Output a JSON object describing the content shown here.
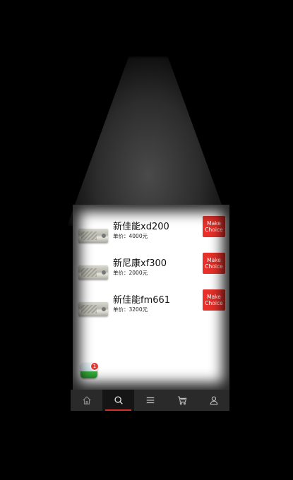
{
  "products": [
    {
      "name": "新佳能xd200",
      "price": "单价：4000元",
      "button": "Make Choice"
    },
    {
      "name": "新尼康xf300",
      "price": "单价：2000元",
      "button": "Make Choice"
    },
    {
      "name": "新佳能fm661",
      "price": "单价：3200元",
      "button": "Make Choice"
    }
  ],
  "floating_app": {
    "icon": "game-center-icon",
    "badge": "1"
  },
  "tabs": [
    {
      "icon": "home-icon",
      "active": false
    },
    {
      "icon": "search-icon",
      "active": true
    },
    {
      "icon": "menu-icon",
      "active": false
    },
    {
      "icon": "cart-icon",
      "active": false
    },
    {
      "icon": "user-icon",
      "active": false
    }
  ],
  "colors": {
    "accent": "#e8312a",
    "tabbar": "#2a2a2a",
    "active_underline": "#d92c2c"
  }
}
